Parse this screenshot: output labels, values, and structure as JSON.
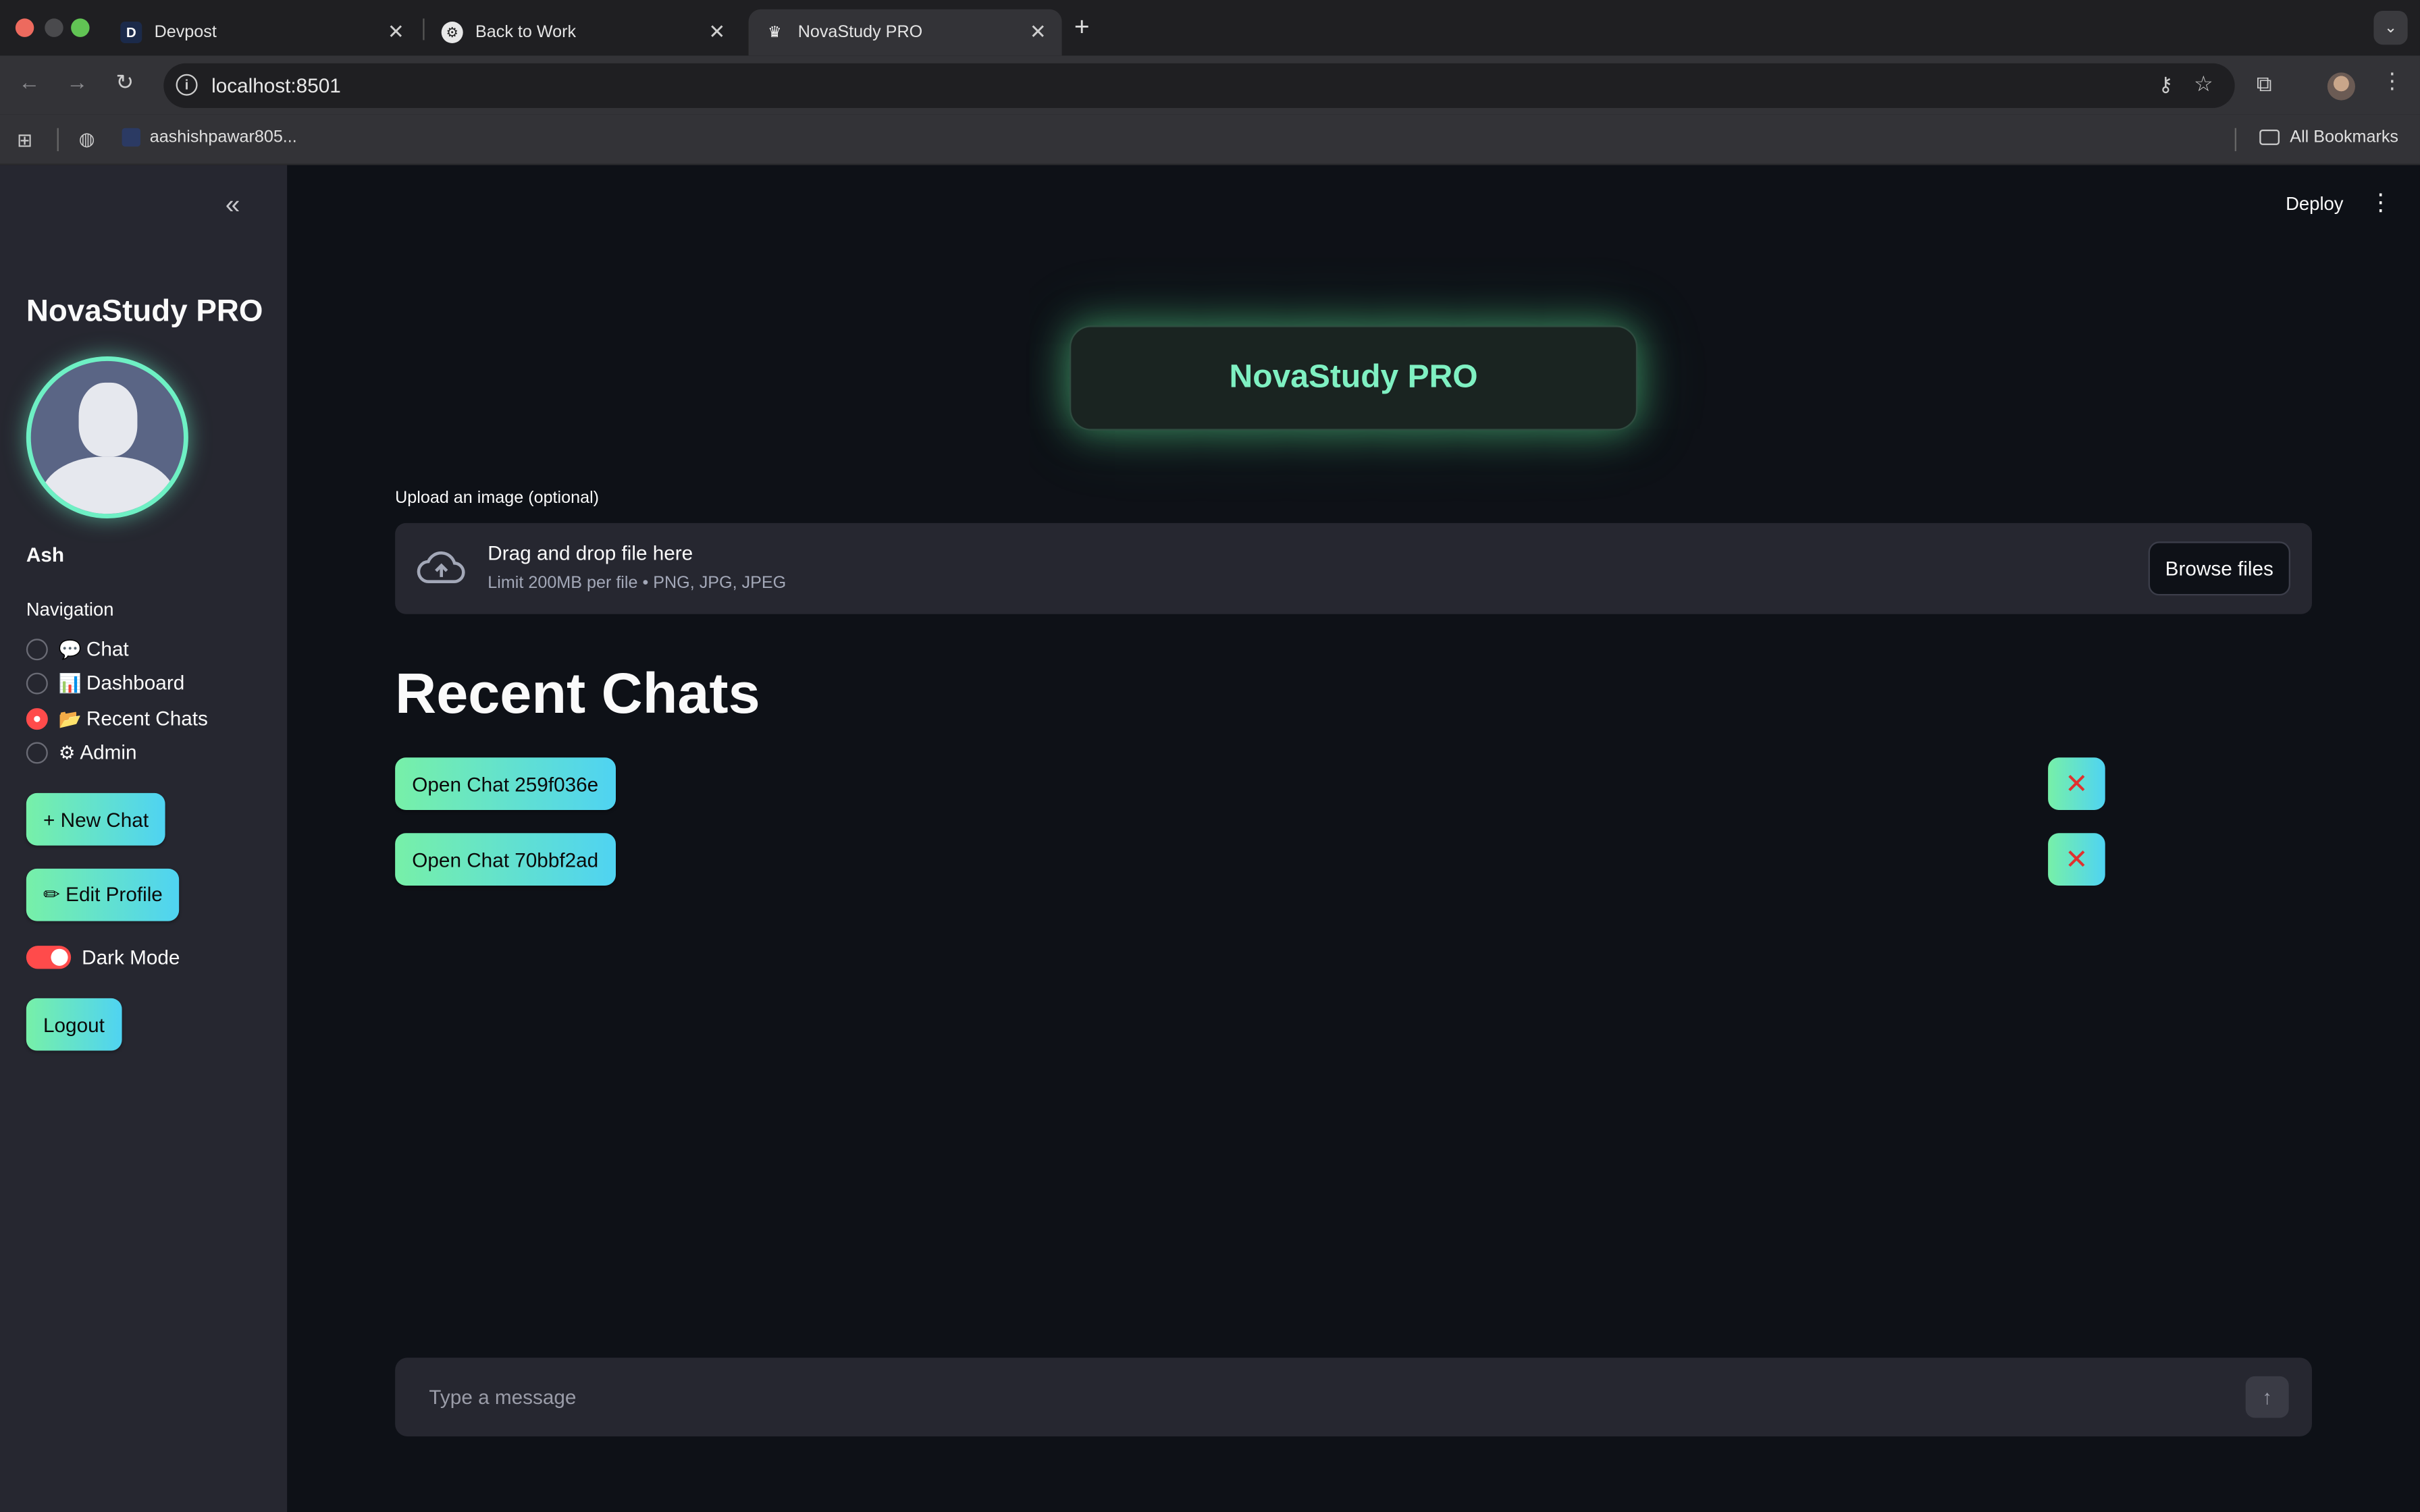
{
  "browser": {
    "tabs": [
      {
        "title": "Devpost",
        "favicon": "D"
      },
      {
        "title": "Back to Work",
        "favicon": "openai-icon"
      },
      {
        "title": "NovaStudy PRO",
        "favicon": "crown-icon"
      }
    ],
    "url": "localhost:8501",
    "bookmark": "aashishpawar805...",
    "all_bookmarks": "All Bookmarks"
  },
  "sidebar": {
    "app_title": "NovaStudy PRO",
    "username": "Ash",
    "nav_label": "Navigation",
    "nav_items": [
      {
        "emoji": "💬",
        "label": "Chat",
        "selected": false
      },
      {
        "emoji": "📊",
        "label": "Dashboard",
        "selected": false
      },
      {
        "emoji": "📂",
        "label": "Recent Chats",
        "selected": true
      },
      {
        "emoji": "⚙",
        "label": "Admin",
        "selected": false
      }
    ],
    "new_chat": "+ New Chat",
    "edit_profile": "✏ Edit Profile",
    "dark_mode": "Dark Mode",
    "dark_mode_on": true,
    "logout": "Logout"
  },
  "header": {
    "deploy": "Deploy"
  },
  "main": {
    "hero_title": "NovaStudy PRO",
    "upload_label": "Upload an image (optional)",
    "dropzone_title": "Drag and drop file here",
    "dropzone_sub": "Limit 200MB per file • PNG, JPG, JPEG",
    "browse": "Browse files",
    "recent_heading": "Recent Chats",
    "chats": [
      {
        "label": "Open Chat 259f036e",
        "delete": "✕"
      },
      {
        "label": "Open Chat 70bbf2ad",
        "delete": "✕"
      }
    ],
    "input_placeholder": "Type a message"
  },
  "colors": {
    "accent_green": "#77f0a8",
    "accent_cyan": "#4fd3f2",
    "hero_text": "#7ff0c2",
    "toggle_red": "#ff4b4b"
  }
}
